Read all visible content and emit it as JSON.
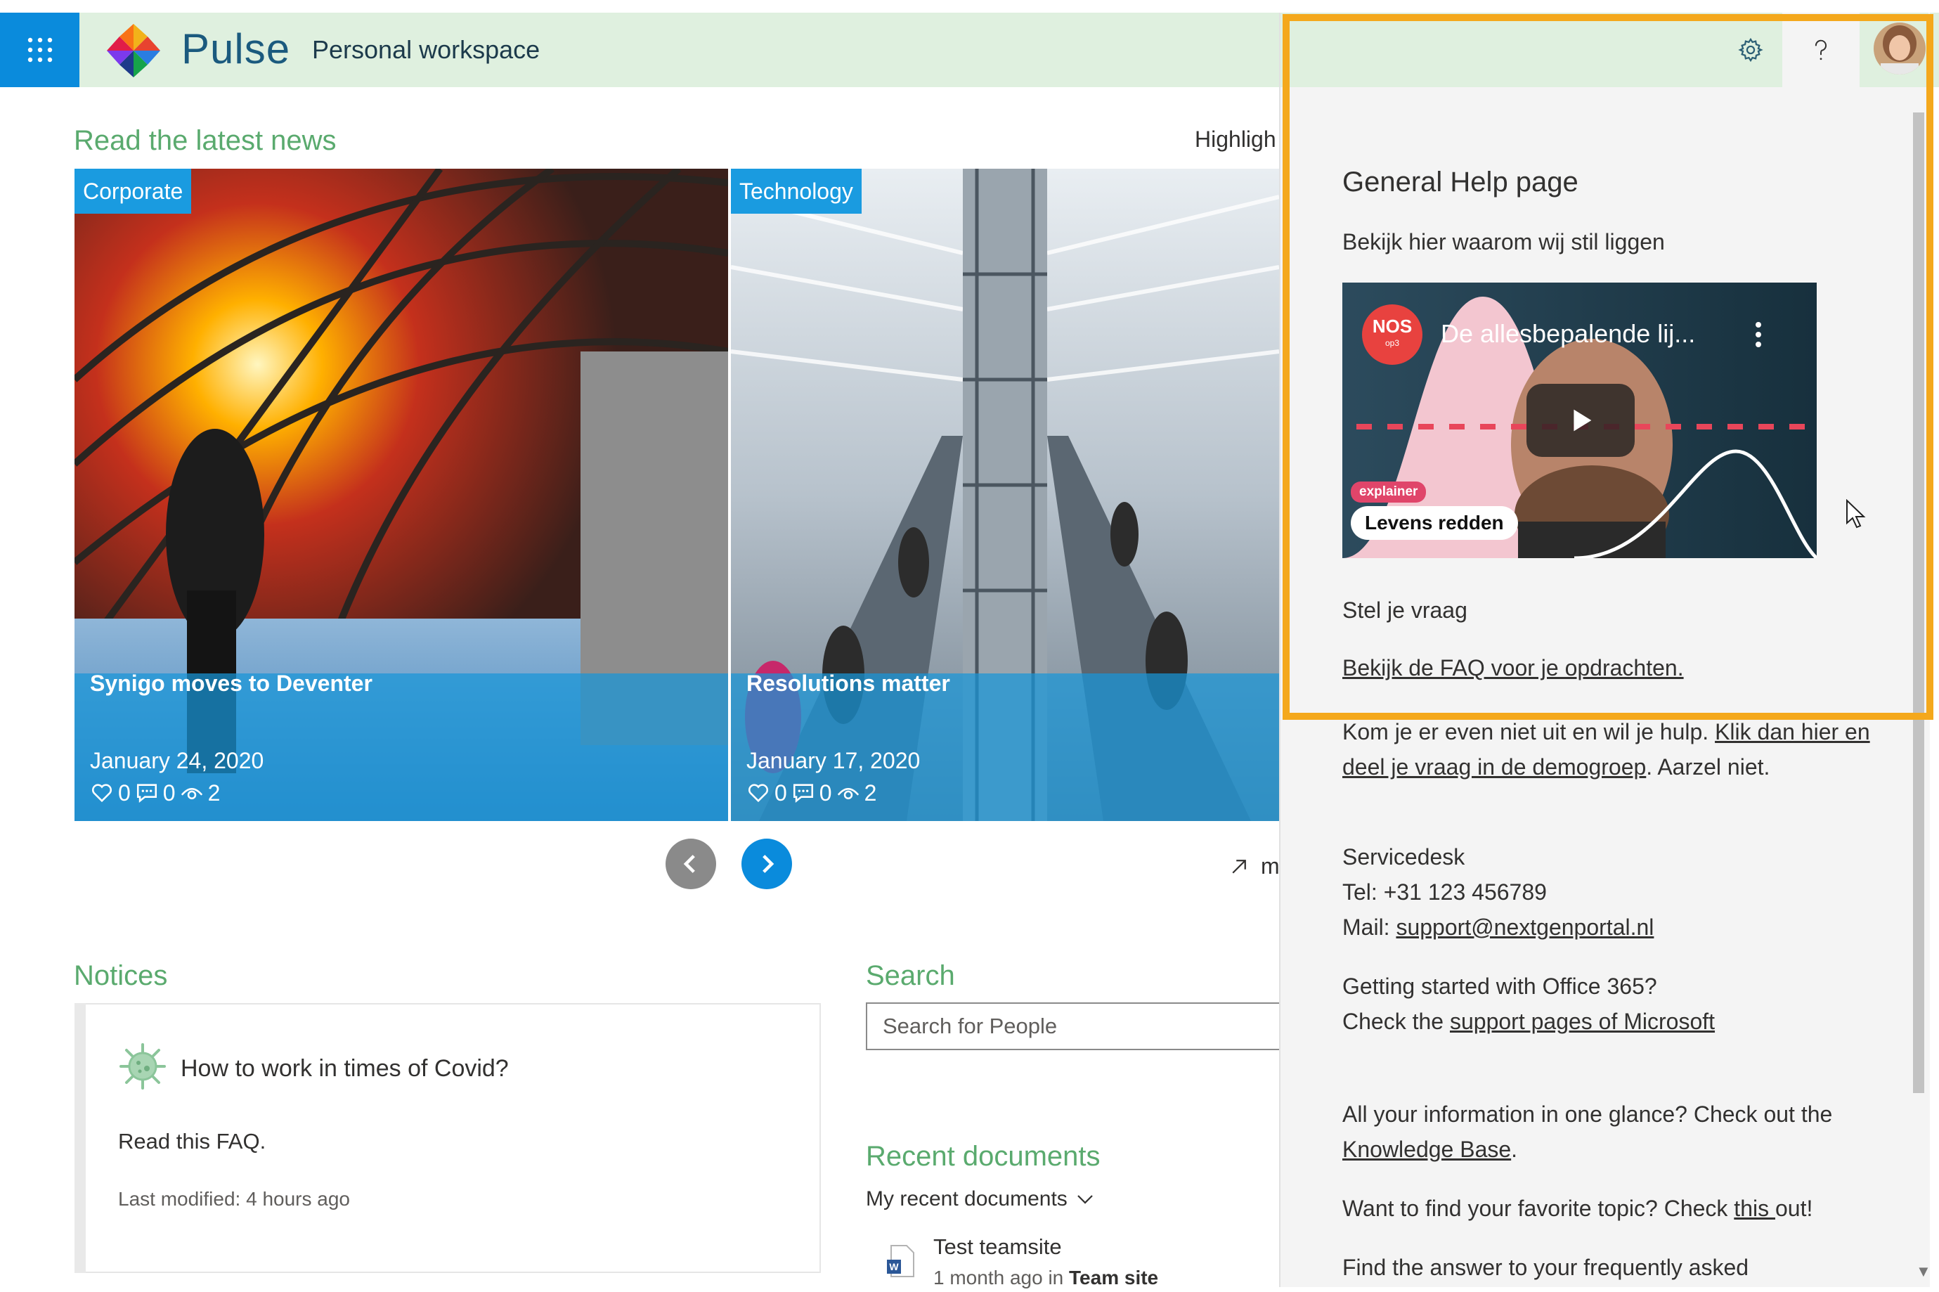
{
  "header": {
    "brand": "Pulse",
    "workspace": "Personal workspace"
  },
  "news": {
    "title": "Read the latest news",
    "highlight_link": "Highligh",
    "more_link": "m",
    "cards": [
      {
        "category": "Corporate",
        "title": "Synigo moves to Deventer",
        "date": "January 24, 2020",
        "likes": "0",
        "comments": "0",
        "views": "2"
      },
      {
        "category": "Technology",
        "title": "Resolutions matter",
        "date": "January 17, 2020",
        "likes": "0",
        "comments": "0",
        "views": "2"
      }
    ]
  },
  "notices": {
    "title": "Notices",
    "heading": "How to work in times of Covid?",
    "body": "Read this FAQ.",
    "modified": "Last modified: 4 hours ago"
  },
  "search": {
    "title": "Search",
    "placeholder": "Search for People"
  },
  "recent": {
    "title": "Recent documents",
    "filter": "My recent documents",
    "doc_name": "Test teamsite",
    "doc_time": "1 month ago",
    "doc_in": "in",
    "doc_location": "Team site"
  },
  "help_panel": {
    "heading": "General Help page",
    "subheading": "Bekijk hier waarom wij stil liggen",
    "video": {
      "channel_top": "NOS",
      "channel_sub": "op3",
      "title": "De allesbepalende lij...",
      "badge": "explainer",
      "caption": "Levens redden"
    },
    "ask_heading": "Stel je vraag",
    "faq_link": "Bekijk de FAQ voor je opdrachten.",
    "covered": {
      "pre": "Kom je er even niet uit en wil je hulp. ",
      "link": "Klik dan hier en deel je vraag in de demogroep",
      "post": ". Aarzel niet."
    },
    "servicedesk_heading": "Servicedesk",
    "tel": "Tel: +31 123 456789",
    "mail_label": "Mail: ",
    "mail_link": "support@nextgenportal.nl",
    "office_heading": "Getting started with Office 365?",
    "office_pre": "Check the ",
    "office_link": "support pages of Microsoft",
    "kb_pre": "All your information in one glance? Check out the ",
    "kb_link": "Knowledge Base",
    "kb_post": ".",
    "fav_pre": "Want to find your favorite topic? Check ",
    "fav_link": "this ",
    "fav_post": "out!",
    "faq_more": "Find the answer to your frequently asked"
  },
  "colors": {
    "accent": "#0a8bdc",
    "section_title": "#5aaa6e",
    "header_bg": "#dff0df",
    "highlight": "#f4a81c"
  },
  "icons": [
    "waffle-icon",
    "settings-icon",
    "help-icon",
    "heart-icon",
    "comment-icon",
    "eye-icon",
    "chevron-left-icon",
    "chevron-right-icon",
    "arrow-up-right-icon",
    "virus-icon",
    "word-doc-icon",
    "chevron-down-icon",
    "play-icon"
  ]
}
